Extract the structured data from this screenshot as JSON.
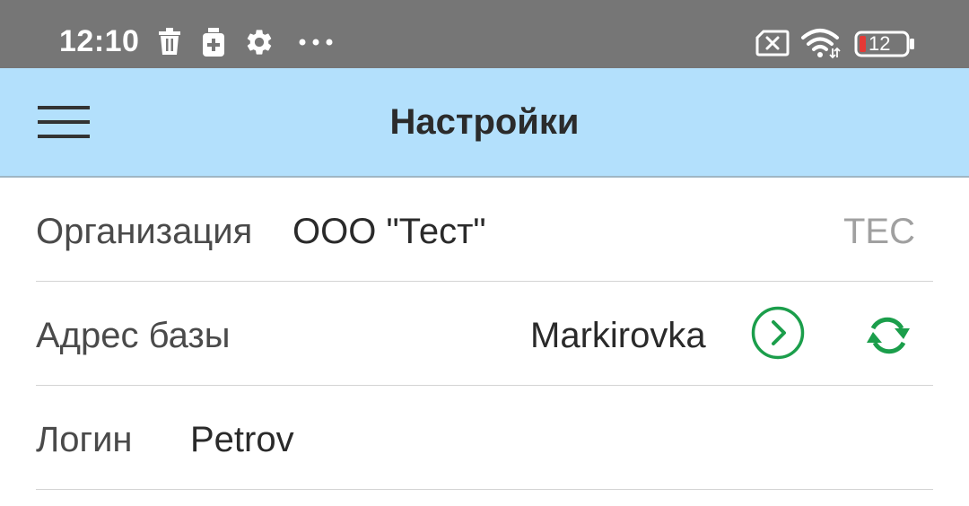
{
  "status_bar": {
    "time": "12:10",
    "battery_level": "12",
    "icons": [
      "trash-icon",
      "medical-kit-icon",
      "gear-icon",
      "more-dots-icon",
      "sim-x-icon",
      "wifi-icon",
      "battery-icon"
    ],
    "battery_low_color": "#e53935"
  },
  "app_bar": {
    "title": "Настройки",
    "menu_icon": "hamburger-menu-icon",
    "background": "#b3e0fc"
  },
  "settings": {
    "organization": {
      "label": "Организация",
      "value": "ООО \"Тест\"",
      "code": "TEC"
    },
    "db_address": {
      "label": "Адрес базы",
      "value": "Markirovka",
      "open_icon": "chevron-right-circle-icon",
      "sync_icon": "sync-icon",
      "accent_color": "#1b9e4b"
    },
    "login": {
      "label": "Логин",
      "value": "Petrov"
    }
  }
}
